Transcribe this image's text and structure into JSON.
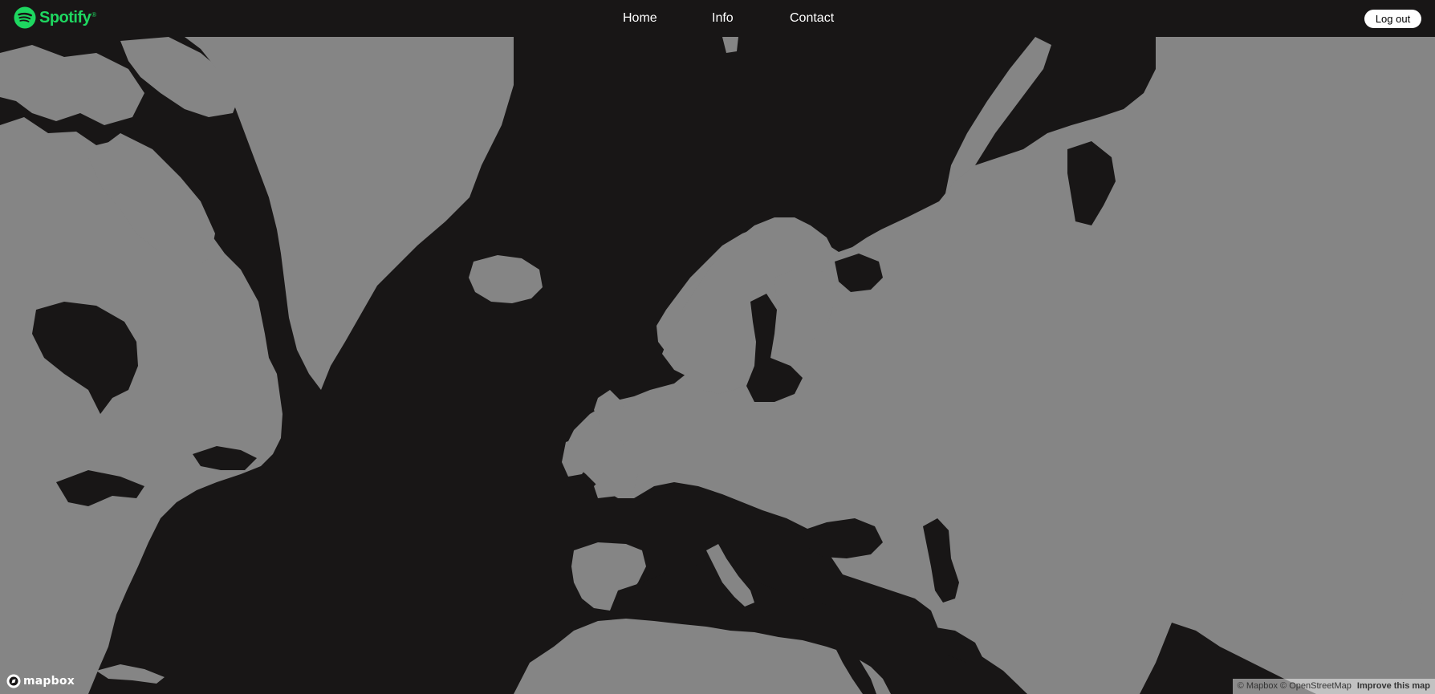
{
  "brand": {
    "name": "Spotify",
    "registered": "®",
    "color": "#1ed760",
    "icon": "spotify-logo-icon"
  },
  "nav": {
    "home": "Home",
    "info": "Info",
    "contact": "Contact"
  },
  "logout_label": "Log out",
  "map": {
    "land_color": "#858585",
    "water_color": "#181616",
    "logo_text": "mapbox",
    "logo_icon": "mapbox-logo-icon",
    "attribution": {
      "mapbox": "© Mapbox",
      "osm": "© OpenStreetMap",
      "improve": "Improve this map"
    }
  }
}
